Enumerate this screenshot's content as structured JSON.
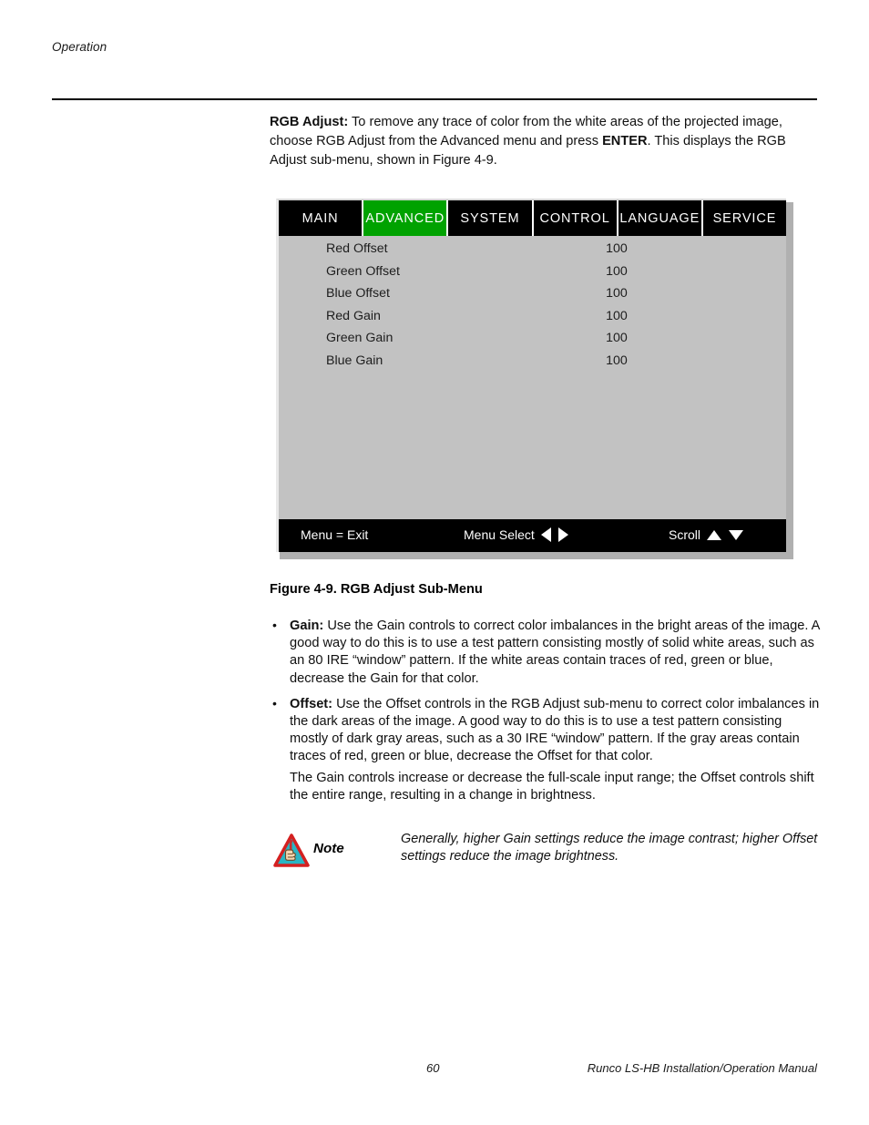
{
  "page": {
    "running_head": "Operation",
    "page_number": "60",
    "manual_title": "Runco LS-HB Installation/Operation Manual"
  },
  "intro": {
    "lead_bold": "RGB Adjust:",
    "text": " To remove any trace of color from the white areas of the projected image, choose RGB Adjust from the Advanced menu and press ",
    "bold_mid": "ENTER",
    "text_end": ". This displays the RGB Adjust sub-menu, shown in Figure 4-9."
  },
  "osd": {
    "tabs": [
      {
        "label": "MAIN",
        "active": false
      },
      {
        "label": "ADVANCED",
        "active": true
      },
      {
        "label": "SYSTEM",
        "active": false
      },
      {
        "label": "CONTROL",
        "active": false
      },
      {
        "label": "LANGUAGE",
        "active": false
      },
      {
        "label": "SERVICE",
        "active": false
      }
    ],
    "active_tab_color": "#00a200",
    "body_color": "#c2c2c2",
    "rows": [
      {
        "label": "Red Offset",
        "value": "100"
      },
      {
        "label": "Green Offset",
        "value": "100"
      },
      {
        "label": "Blue Offset",
        "value": "100"
      },
      {
        "label": "Red Gain",
        "value": "100"
      },
      {
        "label": "Green Gain",
        "value": "100"
      },
      {
        "label": "Blue Gain",
        "value": "100"
      }
    ],
    "footer": {
      "exit": "Menu = Exit",
      "select": "Menu Select",
      "scroll": "Scroll"
    }
  },
  "figure": {
    "caption": "Figure 4-9. RGB Adjust Sub-Menu"
  },
  "bullets": [
    {
      "term": "Gain:",
      "text": " Use the Gain controls to correct color imbalances in the bright areas of the image. A good way to do this is to use a test pattern consisting mostly of solid white areas, such as an 80 IRE “window” pattern. If the white areas contain traces of red, green or blue, decrease the Gain for that color."
    },
    {
      "term": "Offset:",
      "text": " Use the Offset controls in the RGB Adjust sub-menu to correct color imbalances in the dark areas of the image. A good way to do this is to use a test pattern consisting mostly of dark gray areas, such as a 30 IRE “window” pattern. If the gray areas contain traces of red, green or blue, decrease the Offset for that color."
    }
  ],
  "closing_paragraph": "The Gain controls increase or decrease the full-scale input range; the Offset controls shift the entire range, resulting in a change in brightness.",
  "note": {
    "label": "Note",
    "text": "Generally, higher Gain settings reduce the image contrast; higher Offset settings reduce the image brightness.",
    "icon_border_color": "#d42020",
    "icon_fill_color": "#2ab5c4"
  }
}
